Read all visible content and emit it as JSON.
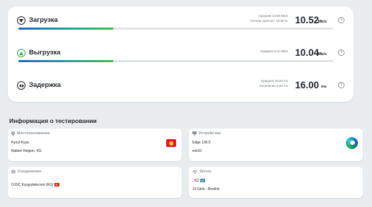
{
  "metrics": {
    "download": {
      "title": "Загрузка",
      "avg": "Средняя 10.58 Mb/s",
      "loss": "Потери пакетов : 16.90 %",
      "value": "10.52",
      "unit": "Mb/s",
      "progress": 0.3
    },
    "upload": {
      "title": "Выгрузка",
      "avg": "Средняя 9.31 Mb/s",
      "value": "10.04",
      "unit": "Mb/s",
      "progress": 0.3
    },
    "latency": {
      "title": "Задержка",
      "avg": "Среднее 20.00 ms",
      "jitter": "Колебание 9.00 ms",
      "value": "16.00",
      "unit": "ms"
    }
  },
  "info": {
    "title": "Информация о тестировании",
    "location": {
      "label": "Местоположение",
      "city": "Kyzyl-Kyya",
      "region": "Batken Region, KG"
    },
    "device": {
      "label": "Устройство",
      "browser": "Edge 130.0",
      "os": "win10"
    },
    "connection": {
      "label": "Соединение",
      "isp": "OJSC Kyrgyztelecom (KG)"
    },
    "server": {
      "label": "Server",
      "country": ", KZ",
      "host": "10 Gb/s - Beeline"
    }
  },
  "colors": {
    "accent_green": "#2fb34a",
    "bar_blue": "#2464bd",
    "kg_red": "#e8112d"
  }
}
